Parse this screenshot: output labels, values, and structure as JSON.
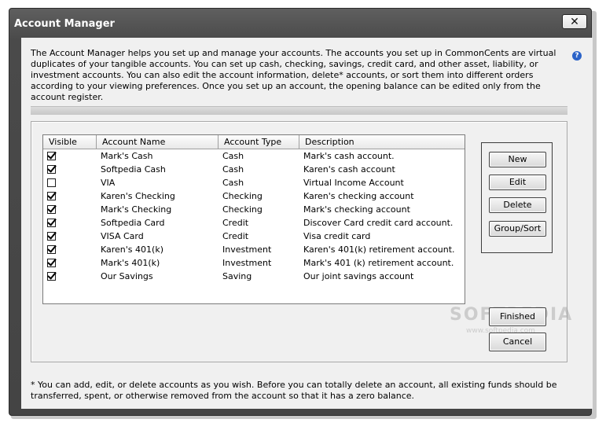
{
  "window": {
    "title": "Account Manager",
    "close_glyph": "✕"
  },
  "intro_text": "The Account Manager helps you set up and manage your accounts. The accounts you set up in CommonCents are virtual duplicates of your tangible accounts. You can set up cash, checking, savings, credit card, and other asset, liability, or investment accounts. You can also edit the account information, delete* accounts, or sort them into different orders according to your viewing preferences. Once you set up an account, the opening balance can be edited only from the account register.",
  "help_glyph": "?",
  "table": {
    "headers": {
      "visible": "Visible",
      "name": "Account Name",
      "type": "Account Type",
      "description": "Description"
    },
    "rows": [
      {
        "visible": true,
        "name": "Mark's Cash",
        "type": "Cash",
        "description": "Mark's cash account."
      },
      {
        "visible": true,
        "name": "Softpedia Cash",
        "type": "Cash",
        "description": "Karen's cash account"
      },
      {
        "visible": false,
        "name": "VIA",
        "type": "Cash",
        "description": "Virtual Income Account"
      },
      {
        "visible": true,
        "name": "Karen's Checking",
        "type": "Checking",
        "description": "Karen's checking account"
      },
      {
        "visible": true,
        "name": "Mark's Checking",
        "type": "Checking",
        "description": "Mark's checking account"
      },
      {
        "visible": true,
        "name": "Softpedia Card",
        "type": "Credit",
        "description": "Discover Card credit card account."
      },
      {
        "visible": true,
        "name": "VISA Card",
        "type": "Credit",
        "description": "Visa credit card"
      },
      {
        "visible": true,
        "name": "Karen's 401(k)",
        "type": "Investment",
        "description": "Karen's 401(k) retirement account."
      },
      {
        "visible": true,
        "name": "Mark's 401(k)",
        "type": "Investment",
        "description": "Mark's 401 (k) retirement account."
      },
      {
        "visible": true,
        "name": "Our Savings",
        "type": "Saving",
        "description": "Our joint savings account"
      }
    ]
  },
  "buttons": {
    "new": "New",
    "edit": "Edit",
    "delete": "Delete",
    "group_sort": "Group/Sort",
    "finished": "Finished",
    "cancel": "Cancel"
  },
  "footnote": "* You can add, edit, or delete accounts as you wish. Before you can totally delete an account, all existing funds should be transferred, spent, or otherwise removed from the account so that it has a zero balance.",
  "watermark": {
    "main": "SOFTPEDIA",
    "sub": "www.softpedia.com"
  }
}
